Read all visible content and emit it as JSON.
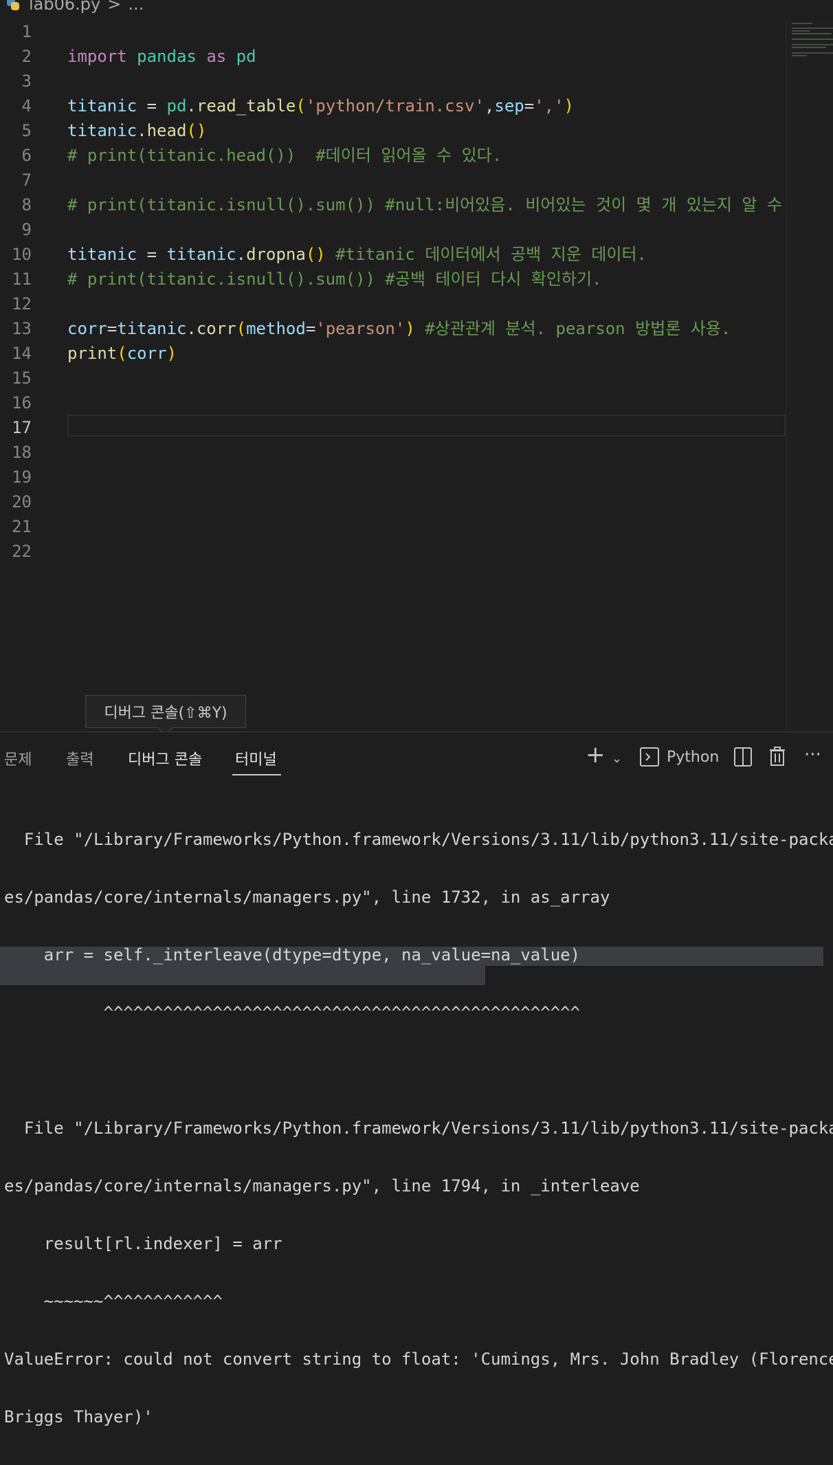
{
  "breadcrumb": {
    "file": "lab06.py",
    "separator": ">",
    "more": "..."
  },
  "editor": {
    "lines": [
      {
        "n": "1"
      },
      {
        "n": "2"
      },
      {
        "n": "3"
      },
      {
        "n": "4"
      },
      {
        "n": "5"
      },
      {
        "n": "6"
      },
      {
        "n": "7"
      },
      {
        "n": "8"
      },
      {
        "n": "9"
      },
      {
        "n": "10"
      },
      {
        "n": "11"
      },
      {
        "n": "12"
      },
      {
        "n": "13"
      },
      {
        "n": "14"
      },
      {
        "n": "15"
      },
      {
        "n": "16"
      },
      {
        "n": "17"
      },
      {
        "n": "18"
      },
      {
        "n": "19"
      },
      {
        "n": "20"
      },
      {
        "n": "21"
      },
      {
        "n": "22"
      }
    ],
    "active_line": "17",
    "code": {
      "l2": {
        "kw1": "import",
        "mod": "pandas",
        "kw2": "as",
        "alias": "pd"
      },
      "l4": {
        "var": "titanic",
        "eq": " = ",
        "mod": "pd",
        "dot": ".",
        "fn": "read_table",
        "open": "(",
        "str1": "'python/train.csv'",
        "comma": ",",
        "param": "sep",
        "eq2": "=",
        "str2": "','",
        "close": ")"
      },
      "l5": {
        "var": "titanic",
        "dot": ".",
        "fn": "head",
        "parens": "()"
      },
      "l6": {
        "comment": "# print(titanic.head())  #데이터 읽어올 수 있다."
      },
      "l8": {
        "comment": "# print(titanic.isnull().sum()) #null:비어있음. 비어있는 것이 몇 개 있는지 알 수 있"
      },
      "l10": {
        "var1": "titanic",
        "eq": " = ",
        "var2": "titanic",
        "dot": ".",
        "fn": "dropna",
        "parens": "()",
        "comment": " #titanic 데이터에서 공백 지운 데이터."
      },
      "l11": {
        "comment": "# print(titanic.isnull().sum()) #공백 테이터 다시 확인하기."
      },
      "l13": {
        "var1": "corr",
        "eq": "=",
        "var2": "titanic",
        "dot": ".",
        "fn": "corr",
        "open": "(",
        "param": "method",
        "eq2": "=",
        "str": "'pearson'",
        "close": ")",
        "comment": " #상관관계 분석. pearson 방법론 사용."
      },
      "l14": {
        "fn": "print",
        "open": "(",
        "var": "corr",
        "close": ")"
      }
    }
  },
  "tooltip": {
    "text": "디버그 콘솔(⇧⌘Y)"
  },
  "panel": {
    "tabs": [
      "문제",
      "출력",
      "디버그 콘솔",
      "터미널"
    ],
    "active_tab": "터미널",
    "terminal_label": "Python",
    "terminal_output": [
      "  File \"/Library/Frameworks/Python.framework/Versions/3.11/lib/python3.11/site-packag",
      "es/pandas/core/internals/managers.py\", line 1732, in as_array",
      "    arr = self._interleave(dtype=dtype, na_value=na_value)",
      "          ^^^^^^^^^^^^^^^^^^^^^^^^^^^^^^^^^^^^^^^^^^^^^^^^",
      "",
      "  File \"/Library/Frameworks/Python.framework/Versions/3.11/lib/python3.11/site-packag",
      "es/pandas/core/internals/managers.py\", line 1794, in _interleave",
      "    result[rl.indexer] = arr",
      "    ~~~~~~^^^^^^^^^^^^",
      "ValueError: could not convert string to float: 'Cumings, Mrs. John Bradley (Florence",
      "Briggs Thayer)'"
    ]
  },
  "colors": {
    "background": "#1e1e1e",
    "keyword": "#c586c0",
    "module": "#4ec9b0",
    "variable": "#9cdcfe",
    "function": "#dcdcaa",
    "string": "#ce9178",
    "comment": "#6a9955"
  }
}
